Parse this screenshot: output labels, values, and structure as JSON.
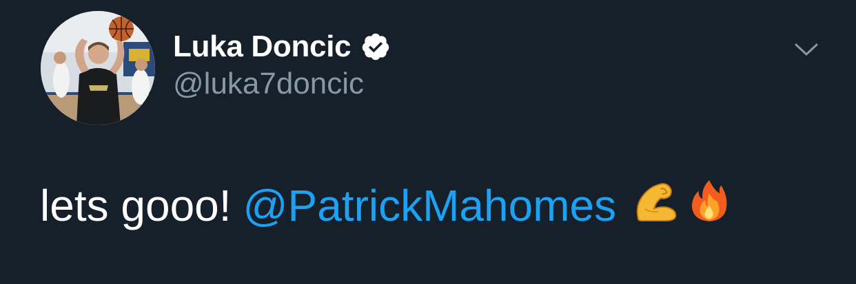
{
  "author": {
    "display_name": "Luka Doncic",
    "handle": "@luka7doncic",
    "verified": true,
    "avatar": "avatar-photo"
  },
  "tweet": {
    "text": "lets gooo!",
    "mention": "@PatrickMahomes",
    "emojis": [
      "flexed-biceps-emoji",
      "fire-emoji"
    ]
  },
  "icons": {
    "verified": "verified-badge-icon",
    "menu": "chevron-down-icon"
  },
  "colors": {
    "background": "#15202b",
    "text": "#ffffff",
    "secondary": "#8899a6",
    "link": "#1da1f2"
  }
}
